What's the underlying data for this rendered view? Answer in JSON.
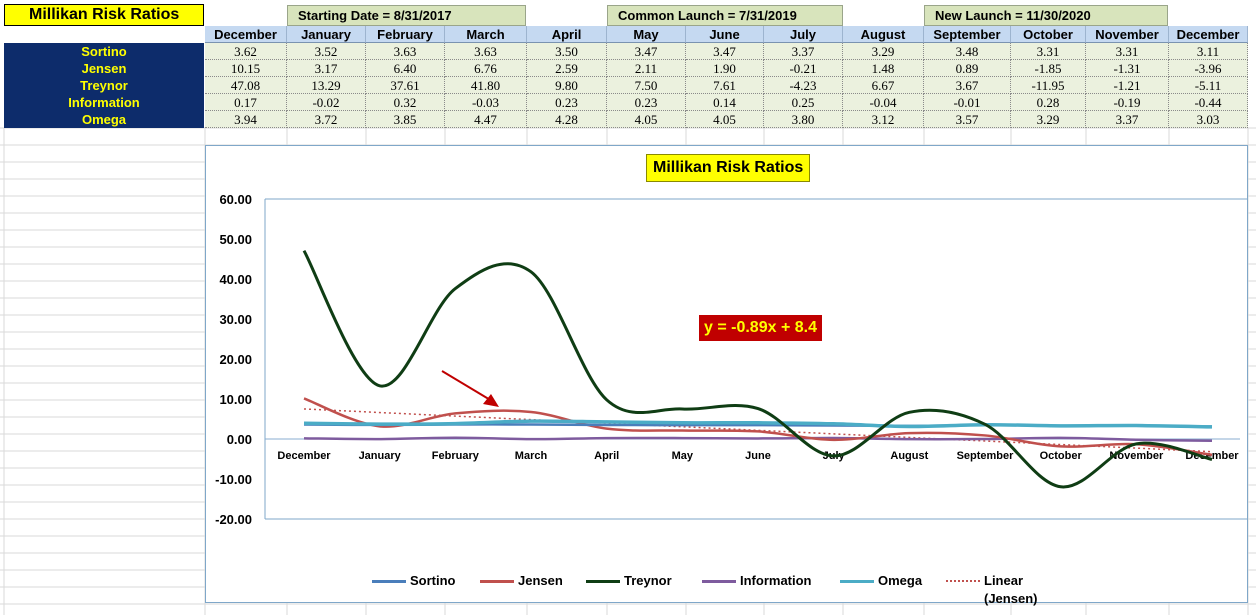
{
  "sheet": {
    "title": "Millikan Risk Ratios",
    "header_notes": [
      {
        "label": "Starting Date = 8/31/2017"
      },
      {
        "label": "Common Launch = 7/31/2019"
      },
      {
        "label": "New Launch = 11/30/2020"
      }
    ],
    "months": [
      "December",
      "January",
      "February",
      "March",
      "April",
      "May",
      "June",
      "July",
      "August",
      "September",
      "October",
      "November",
      "December"
    ],
    "rows": [
      {
        "name": "Sortino",
        "values": [
          "3.62",
          "3.52",
          "3.63",
          "3.63",
          "3.50",
          "3.47",
          "3.47",
          "3.37",
          "3.29",
          "3.48",
          "3.31",
          "3.31",
          "3.11"
        ]
      },
      {
        "name": "Jensen",
        "values": [
          "10.15",
          "3.17",
          "6.40",
          "6.76",
          "2.59",
          "2.11",
          "1.90",
          "-0.21",
          "1.48",
          "0.89",
          "-1.85",
          "-1.31",
          "-3.96"
        ]
      },
      {
        "name": "Treynor",
        "values": [
          "47.08",
          "13.29",
          "37.61",
          "41.80",
          "9.80",
          "7.50",
          "7.61",
          "-4.23",
          "6.67",
          "3.67",
          "-11.95",
          "-1.21",
          "-5.11"
        ]
      },
      {
        "name": "Information",
        "values": [
          "0.17",
          "-0.02",
          "0.32",
          "-0.03",
          "0.23",
          "0.23",
          "0.14",
          "0.25",
          "-0.04",
          "-0.01",
          "0.28",
          "-0.19",
          "-0.44"
        ]
      },
      {
        "name": "Omega",
        "values": [
          "3.94",
          "3.72",
          "3.85",
          "4.47",
          "4.28",
          "4.05",
          "4.05",
          "3.80",
          "3.12",
          "3.57",
          "3.29",
          "3.37",
          "3.03"
        ]
      }
    ]
  },
  "chart_data": {
    "type": "line",
    "title": "Millikan Risk Ratios",
    "categories": [
      "December",
      "January",
      "February",
      "March",
      "April",
      "May",
      "June",
      "July",
      "August",
      "September",
      "October",
      "November",
      "December"
    ],
    "ylim": [
      -20,
      60
    ],
    "yticks": [
      "60.00",
      "50.00",
      "40.00",
      "30.00",
      "20.00",
      "10.00",
      "0.00",
      "-10.00",
      "-20.00"
    ],
    "grid": false,
    "legend_position": "bottom",
    "series": [
      {
        "name": "Sortino",
        "color": "#4a7ebb",
        "values": [
          3.62,
          3.52,
          3.63,
          3.63,
          3.5,
          3.47,
          3.47,
          3.37,
          3.29,
          3.48,
          3.31,
          3.31,
          3.11
        ]
      },
      {
        "name": "Jensen",
        "color": "#c0504d",
        "values": [
          10.15,
          3.17,
          6.4,
          6.76,
          2.59,
          2.11,
          1.9,
          -0.21,
          1.48,
          0.89,
          -1.85,
          -1.31,
          -3.96
        ]
      },
      {
        "name": "Treynor",
        "color": "#0f3d14",
        "values": [
          47.08,
          13.29,
          37.61,
          41.8,
          9.8,
          7.5,
          7.61,
          -4.23,
          6.67,
          3.67,
          -11.95,
          -1.21,
          -5.11
        ]
      },
      {
        "name": "Information",
        "color": "#7e5b9e",
        "values": [
          0.17,
          -0.02,
          0.32,
          -0.03,
          0.23,
          0.23,
          0.14,
          0.25,
          -0.04,
          -0.01,
          0.28,
          -0.19,
          -0.44
        ]
      },
      {
        "name": "Omega",
        "color": "#4bacc6",
        "values": [
          3.94,
          3.72,
          3.85,
          4.47,
          4.28,
          4.05,
          4.05,
          3.8,
          3.12,
          3.57,
          3.29,
          3.37,
          3.03
        ]
      }
    ],
    "trendline": {
      "name": "Linear (Jensen)",
      "color": "#c0504d",
      "slope": -0.89,
      "intercept": 8.4
    },
    "annotation": {
      "text": "y = -0.89x + 8.4",
      "bg": "#c00000",
      "fg": "#ffff00"
    },
    "arrow_color": "#c00000"
  }
}
